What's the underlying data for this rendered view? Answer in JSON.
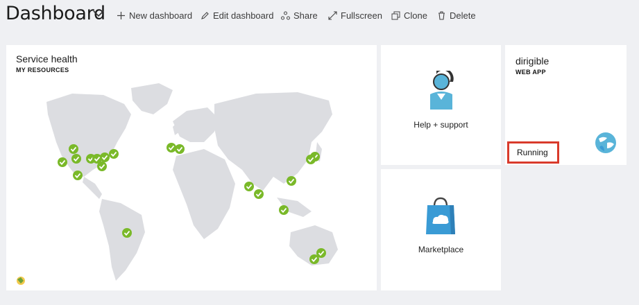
{
  "header": {
    "title": "Dashboard",
    "toolbar": [
      {
        "label": "New dashboard",
        "icon": "plus-icon"
      },
      {
        "label": "Edit dashboard",
        "icon": "pencil-icon"
      },
      {
        "label": "Share",
        "icon": "share-icon"
      },
      {
        "label": "Fullscreen",
        "icon": "fullscreen-icon"
      },
      {
        "label": "Clone",
        "icon": "clone-icon"
      },
      {
        "label": "Delete",
        "icon": "trash-icon"
      }
    ]
  },
  "service_health": {
    "title": "Service health",
    "subtitle": "MY RESOURCES",
    "status_icon": "green-check-icon",
    "status_color": "#7ab929"
  },
  "help": {
    "label": "Help + support",
    "icon": "help-support-icon"
  },
  "marketplace": {
    "label": "Marketplace",
    "icon": "marketplace-bag-icon"
  },
  "web_app": {
    "name": "dirigible",
    "type": "WEB APP",
    "status": "Running",
    "icon": "web-app-globe-icon",
    "highlight_color": "#d93a2b"
  },
  "colors": {
    "background": "#eff0f3",
    "land": "#dcdde1",
    "accent": "#3a9bd5"
  }
}
